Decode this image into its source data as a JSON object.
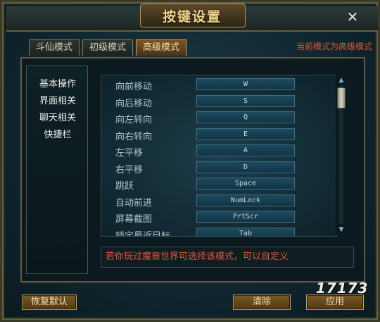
{
  "window": {
    "title": "按键设置",
    "close_label": "✕"
  },
  "tabs": [
    {
      "label": "斗仙模式",
      "active": false
    },
    {
      "label": "初级模式",
      "active": false
    },
    {
      "label": "高级模式",
      "active": true
    }
  ],
  "mode_status": "当前模式为高级模式",
  "categories": [
    {
      "label": "基本操作"
    },
    {
      "label": "界面相关"
    },
    {
      "label": "聊天相关"
    },
    {
      "label": "快捷栏"
    }
  ],
  "key_bindings": [
    {
      "action": "向前移动",
      "key": "W"
    },
    {
      "action": "向后移动",
      "key": "S"
    },
    {
      "action": "向左转向",
      "key": "Q"
    },
    {
      "action": "向右转向",
      "key": "E"
    },
    {
      "action": "左平移",
      "key": "A"
    },
    {
      "action": "右平移",
      "key": "D"
    },
    {
      "action": "跳跃",
      "key": "Space"
    },
    {
      "action": "自动前进",
      "key": "NumLock"
    },
    {
      "action": "屏幕截图",
      "key": "PrtScr"
    },
    {
      "action": "锁定最近目标",
      "key": "Tab"
    }
  ],
  "scroll": {
    "up_icon": "▲",
    "down_icon": "▼"
  },
  "hint": "若你玩过魔兽世界可选择该模式，可以自定义",
  "buttons": {
    "restore_default": "恢复默认",
    "clear": "清除",
    "apply": "应用"
  },
  "watermark": "17173"
}
